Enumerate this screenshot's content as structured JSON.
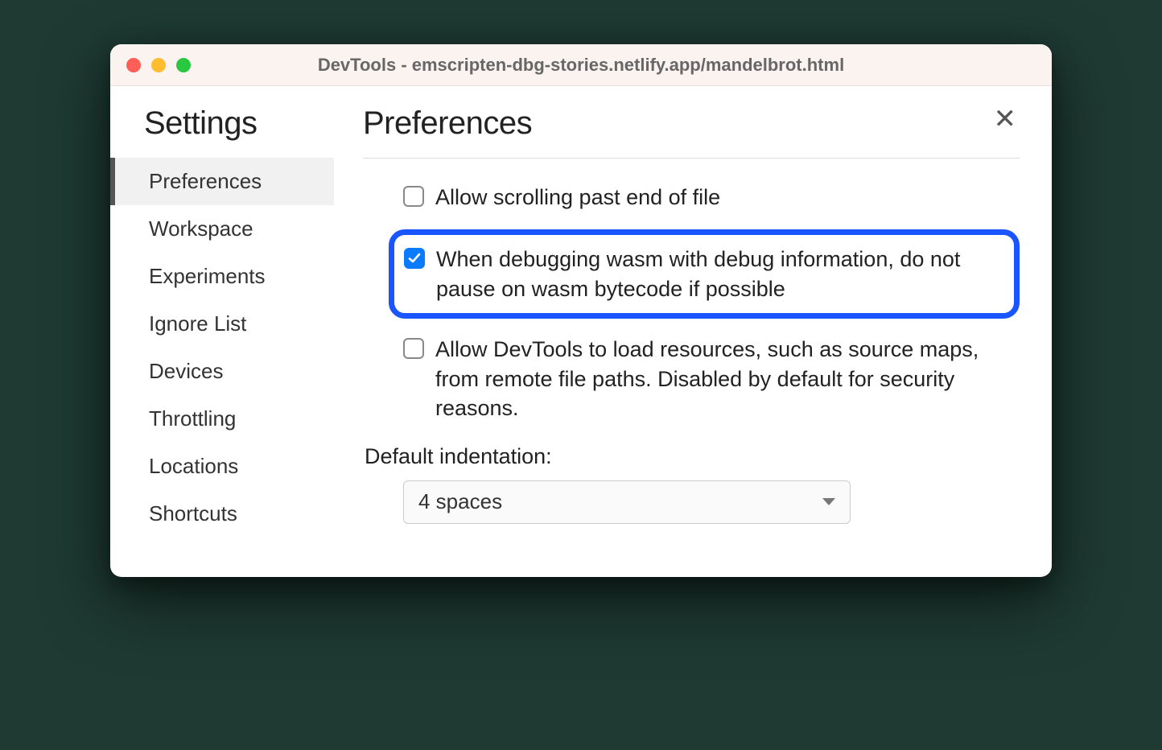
{
  "window": {
    "title": "DevTools - emscripten-dbg-stories.netlify.app/mandelbrot.html"
  },
  "sidebar": {
    "title": "Settings",
    "items": [
      {
        "label": "Preferences",
        "selected": true
      },
      {
        "label": "Workspace",
        "selected": false
      },
      {
        "label": "Experiments",
        "selected": false
      },
      {
        "label": "Ignore List",
        "selected": false
      },
      {
        "label": "Devices",
        "selected": false
      },
      {
        "label": "Throttling",
        "selected": false
      },
      {
        "label": "Locations",
        "selected": false
      },
      {
        "label": "Shortcuts",
        "selected": false
      }
    ]
  },
  "main": {
    "title": "Preferences",
    "checks": [
      {
        "label": "Allow scrolling past end of file",
        "checked": false,
        "highlighted": false
      },
      {
        "label": "When debugging wasm with debug information, do not pause on wasm bytecode if possible",
        "checked": true,
        "highlighted": true
      },
      {
        "label": "Allow DevTools to load resources, such as source maps, from remote file paths. Disabled by default for security reasons.",
        "checked": false,
        "highlighted": false
      }
    ],
    "indentation": {
      "label": "Default indentation:",
      "value": "4 spaces"
    }
  }
}
